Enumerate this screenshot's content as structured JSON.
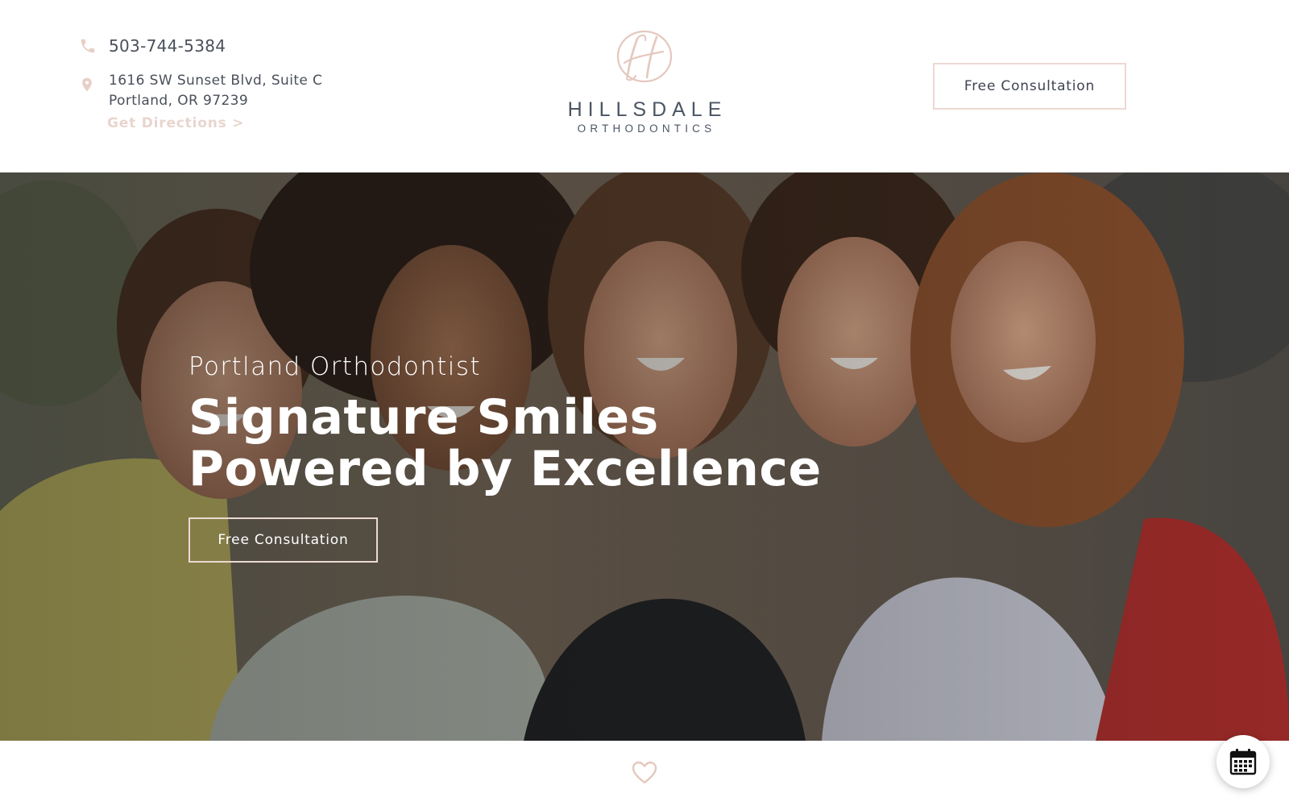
{
  "header": {
    "phone": "503-744-5384",
    "address_line1": "1616 SW Sunset Blvd, Suite C",
    "address_line2": "Portland, OR 97239",
    "directions_link": "Get Directions >",
    "logo_name": "HILLSDALE",
    "logo_sub": "ORTHODONTICS",
    "cta_label": "Free Consultation",
    "icons": [
      "phone-icon",
      "location-pin-icon"
    ]
  },
  "hero": {
    "subtitle": "Portland Orthodontist",
    "title_line1": "Signature Smiles",
    "title_line2": "Powered by Excellence",
    "cta_label": "Free Consultation"
  },
  "footer": {
    "icons": [
      "heart-icon",
      "calendar-icon"
    ]
  },
  "colors": {
    "accent_pink": "#ecd9d2",
    "logo_text": "#4b5563",
    "body_text": "#4a4f5a",
    "hero_text": "#ffffff"
  }
}
